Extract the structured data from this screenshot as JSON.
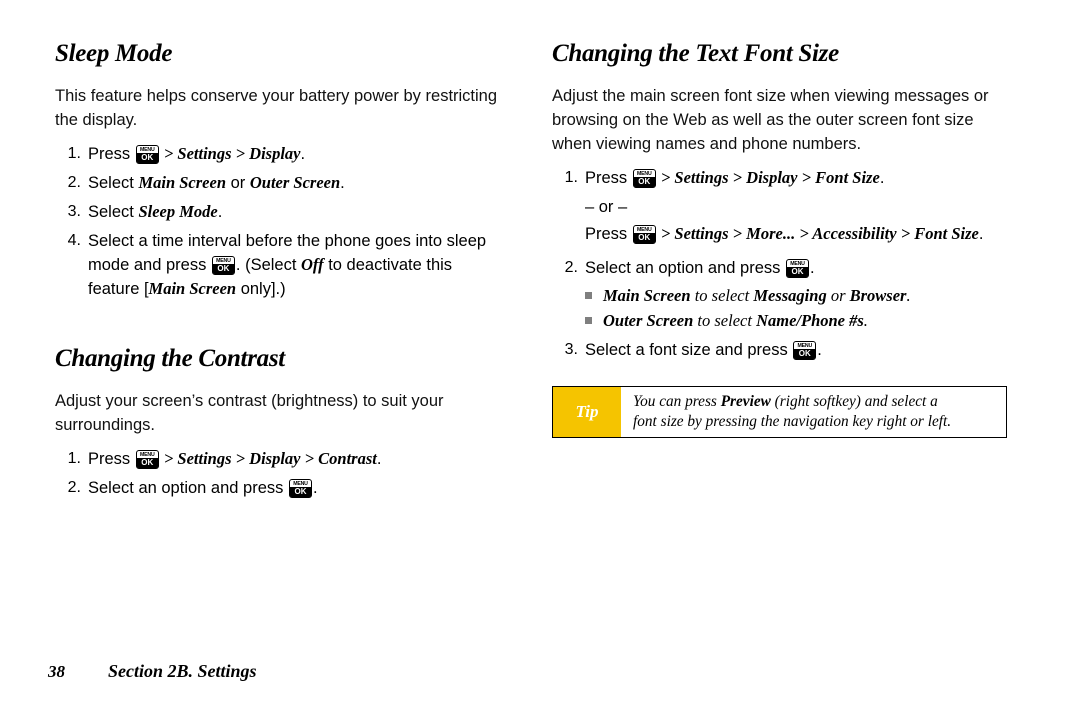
{
  "page": {
    "number": "38",
    "footer_section": "Section 2B. Settings"
  },
  "left_column": {
    "section1": {
      "heading": "Sleep Mode",
      "intro": "This feature helps conserve your battery power by restricting the display.",
      "steps": [
        {
          "parts": [
            {
              "t": "text",
              "v": "Press "
            },
            {
              "t": "key",
              "v": "MENU/OK"
            },
            {
              "t": "ital",
              "v": " > Settings > Display"
            },
            {
              "t": "text",
              "v": "."
            }
          ]
        },
        {
          "parts": [
            {
              "t": "text",
              "v": "Select "
            },
            {
              "t": "ital",
              "v": "Main Screen"
            },
            {
              "t": "text",
              "v": " or "
            },
            {
              "t": "ital",
              "v": "Outer Screen"
            },
            {
              "t": "text",
              "v": "."
            }
          ]
        },
        {
          "parts": [
            {
              "t": "text",
              "v": "Select "
            },
            {
              "t": "ital",
              "v": "Sleep Mode"
            },
            {
              "t": "text",
              "v": "."
            }
          ]
        },
        {
          "parts": [
            {
              "t": "text",
              "v": "Select a time interval before the phone goes into sleep mode and press "
            },
            {
              "t": "key",
              "v": "MENU/OK"
            },
            {
              "t": "text",
              "v": ". (Select "
            },
            {
              "t": "ital",
              "v": "Off"
            },
            {
              "t": "text",
              "v": " to deactivate this feature ["
            },
            {
              "t": "ital",
              "v": "Main Screen"
            },
            {
              "t": "text",
              "v": " only].)"
            }
          ]
        }
      ]
    },
    "section2": {
      "heading": "Changing the Contrast",
      "intro": "Adjust your screen’s contrast (brightness) to suit your surroundings.",
      "steps": [
        {
          "parts": [
            {
              "t": "text",
              "v": "Press "
            },
            {
              "t": "key",
              "v": "MENU/OK"
            },
            {
              "t": "ital",
              "v": " > Settings > Display > Contrast"
            },
            {
              "t": "text",
              "v": "."
            }
          ]
        },
        {
          "parts": [
            {
              "t": "text",
              "v": "Select an option and press "
            },
            {
              "t": "key",
              "v": "MENU/OK"
            },
            {
              "t": "text",
              "v": "."
            }
          ]
        }
      ]
    }
  },
  "right_column": {
    "heading": "Changing the Text Font Size",
    "intro": "Adjust the main screen font size when viewing messages or browsing on the Web as well as the outer screen font size when viewing names and phone numbers.",
    "step1": {
      "parts": [
        {
          "t": "text",
          "v": "Press "
        },
        {
          "t": "key",
          "v": "MENU/OK"
        },
        {
          "t": "ital",
          "v": " > Settings > Display > Font Size"
        },
        {
          "t": "text",
          "v": "."
        }
      ]
    },
    "or_text": "– or –",
    "step1_alt": {
      "parts": [
        {
          "t": "text",
          "v": "Press "
        },
        {
          "t": "key",
          "v": "MENU/OK"
        },
        {
          "t": "ital",
          "v": " > Settings > More... > Accessibility > Font Size"
        },
        {
          "t": "text",
          "v": "."
        }
      ]
    },
    "step2": {
      "parts": [
        {
          "t": "text",
          "v": "Select an option and press "
        },
        {
          "t": "key",
          "v": "MENU/OK"
        },
        {
          "t": "text",
          "v": "."
        }
      ]
    },
    "sub_bullets": [
      {
        "parts": [
          {
            "t": "bold",
            "v": "Main Screen"
          },
          {
            "t": "plain",
            "v": " to select "
          },
          {
            "t": "bold",
            "v": "Messaging"
          },
          {
            "t": "plain",
            "v": " or "
          },
          {
            "t": "bold",
            "v": "Browser"
          },
          {
            "t": "plain",
            "v": "."
          }
        ]
      },
      {
        "parts": [
          {
            "t": "bold",
            "v": "Outer Screen"
          },
          {
            "t": "plain",
            "v": " to select "
          },
          {
            "t": "bold",
            "v": "Name/Phone #s"
          },
          {
            "t": "plain",
            "v": "."
          }
        ]
      }
    ],
    "step3": {
      "parts": [
        {
          "t": "text",
          "v": "Select a font size and press "
        },
        {
          "t": "key",
          "v": "MENU/OK"
        },
        {
          "t": "text",
          "v": "."
        }
      ]
    },
    "tip": {
      "label": "Tip",
      "line1_pre": "You can press ",
      "line1_bold": "Preview",
      "line1_post": " (right softkey) and select a",
      "line2": "font size by pressing the navigation key right or left."
    }
  },
  "keycap": {
    "top_label": "MENU",
    "bottom_label": "OK"
  },
  "colors": {
    "tip_label_bg": "#f5c400",
    "bullet_square": "#7f7f7f",
    "text": "#000000"
  }
}
